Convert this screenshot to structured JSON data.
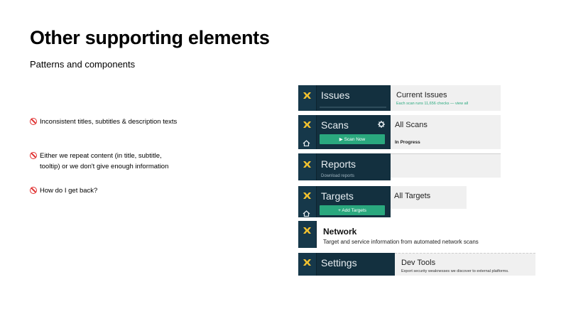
{
  "slide": {
    "title": "Other supporting elements",
    "subtitle": "Patterns and components"
  },
  "bullets": [
    {
      "icon": "prohibited-icon",
      "text": "Inconsistent titles, subtitles & description texts"
    },
    {
      "icon": "prohibited-icon",
      "text": "Either we repeat content (in title, subtitle, tooltip) or we don't give enough information"
    },
    {
      "icon": "prohibited-icon",
      "text": "How do I get back?"
    }
  ],
  "examples": {
    "issues": {
      "nav_label": "Issues",
      "panel_title": "Current Issues",
      "panel_text": "Each scan runs 11,656 checks — view all"
    },
    "scans": {
      "nav_label": "Scans",
      "button": "▶  Scan Now",
      "panel_title": "All Scans",
      "panel_text": "In Progress"
    },
    "reports": {
      "nav_label": "Reports",
      "sub_label": "Download reports"
    },
    "targets": {
      "nav_label": "Targets",
      "button": "+  Add Targets",
      "panel_title": "All Targets"
    },
    "network": {
      "title": "Network",
      "description": "Target and service information from automated network scans"
    },
    "settings": {
      "nav_label": "Settings",
      "panel_title": "Dev Tools",
      "panel_text": "Export security weaknesses we discover to external platforms."
    }
  },
  "colors": {
    "navy": "#13303f",
    "teal": "#2aa87e",
    "logo_yellow": "#f2c230",
    "panel_grey": "#f0f0f0",
    "prohibited_red": "#e03131"
  }
}
